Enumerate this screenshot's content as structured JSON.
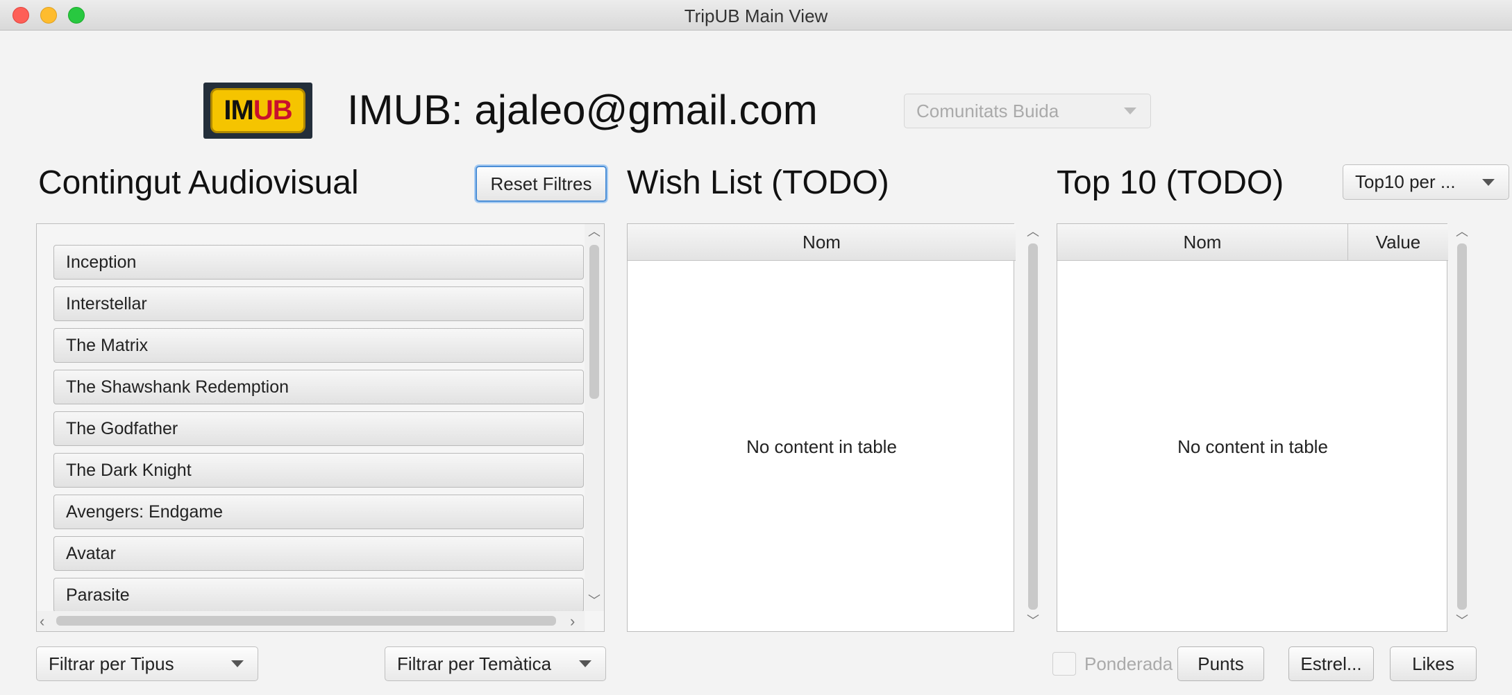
{
  "window": {
    "title": "TripUB Main View"
  },
  "header": {
    "logo": "IMUB",
    "user_title": "IMUB: ajaleo@gmail.com",
    "communities_select": "Comunitats Buida"
  },
  "audiovisual": {
    "title": "Contingut Audiovisual",
    "reset_label": "Reset Filtres",
    "items": [
      "Inception",
      "Interstellar",
      "The Matrix",
      "The Shawshank Redemption",
      "The Godfather",
      "The Dark Knight",
      "Avengers: Endgame",
      "Avatar",
      "Parasite"
    ],
    "filter_type": "Filtrar per Tipus",
    "filter_theme": "Filtrar per Temàtica"
  },
  "wishlist": {
    "title": "Wish List (TODO)",
    "columns": [
      "Nom"
    ],
    "empty_text": "No content in table"
  },
  "top10": {
    "title": "Top 10 (TODO)",
    "sort_select": "Top10 per ...",
    "columns": [
      "Nom",
      "Value"
    ],
    "empty_text": "No content in table",
    "weighted_label": "Ponderada",
    "weighted_checked": false,
    "buttons": {
      "points": "Punts",
      "stars": "Estrel...",
      "likes": "Likes"
    }
  },
  "colors": {
    "focus_ring": "#4b8ed6",
    "close": "#fe5f57",
    "minimize": "#febc2e",
    "maximize": "#28c840",
    "logo_yellow": "#f5c400",
    "logo_red": "#c8102e"
  }
}
